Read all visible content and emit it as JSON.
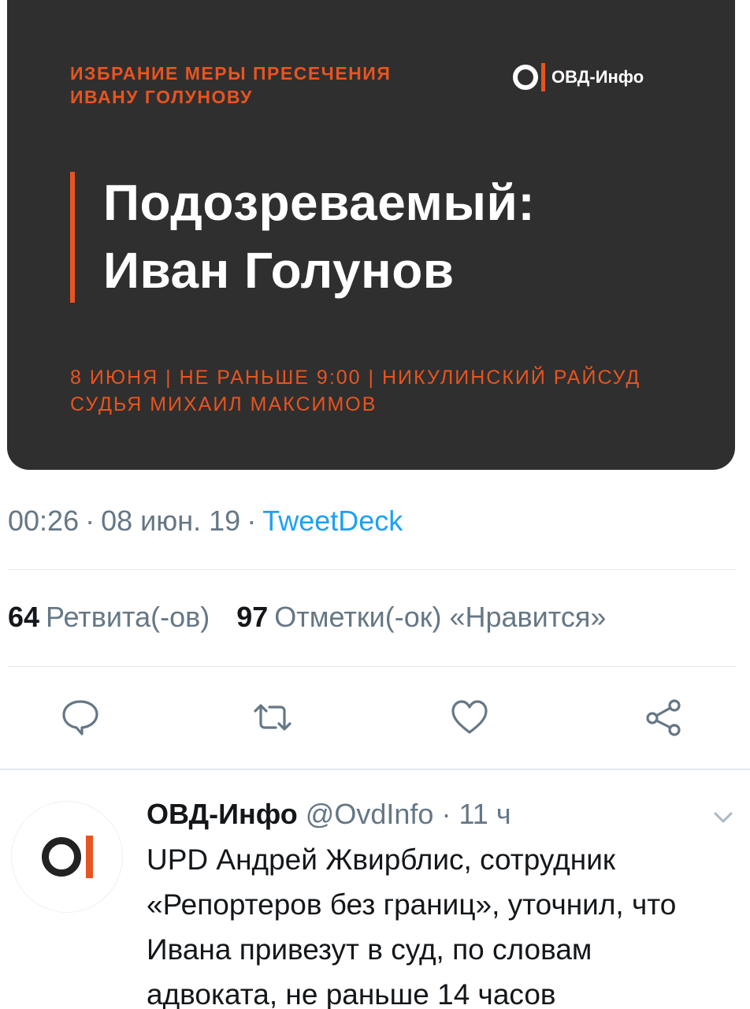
{
  "media_card": {
    "kicker_line1": "ИЗБРАНИЕ МЕРЫ ПРЕСЕЧЕНИЯ",
    "kicker_line2": "ИВАНУ ГОЛУНОВУ",
    "logo_text": "ОВД-Инфо",
    "headline_line1": "Подозреваемый:",
    "headline_line2": "Иван Голунов",
    "details_line1": "8 ИЮНЯ | НЕ РАНЬШЕ 9:00 | НИКУЛИНСКИЙ РАЙСУД",
    "details_line2": "СУДЬЯ МИХАИЛ МАКСИМОВ",
    "colors": {
      "background": "#2f2f2f",
      "accent": "#e85420",
      "text": "#ffffff"
    }
  },
  "meta": {
    "time": "00:26",
    "date": "08 июн. 19",
    "separator": "·",
    "client": "TweetDeck"
  },
  "stats": {
    "retweets_count": "64",
    "retweets_label": "Ретвита(-ов)",
    "likes_count": "97",
    "likes_label": "Отметки(-ок) «Нравится»"
  },
  "actions": [
    {
      "icon": "reply-icon"
    },
    {
      "icon": "retweet-icon"
    },
    {
      "icon": "heart-icon"
    },
    {
      "icon": "share-icon"
    }
  ],
  "reply": {
    "display_name": "ОВД-Инфо",
    "handle": "@OvdInfo",
    "separator": "·",
    "time": "11 ч",
    "body_lines": [
      "UPD Андрей Жвирблис, сотрудник",
      "«Репортеров без границ», уточнил, что",
      "Ивана привезут в суд, по словам",
      "адвоката, не раньше 14 часов"
    ]
  },
  "colors": {
    "link": "#1da1f2",
    "muted": "#657786",
    "text": "#14171a"
  }
}
